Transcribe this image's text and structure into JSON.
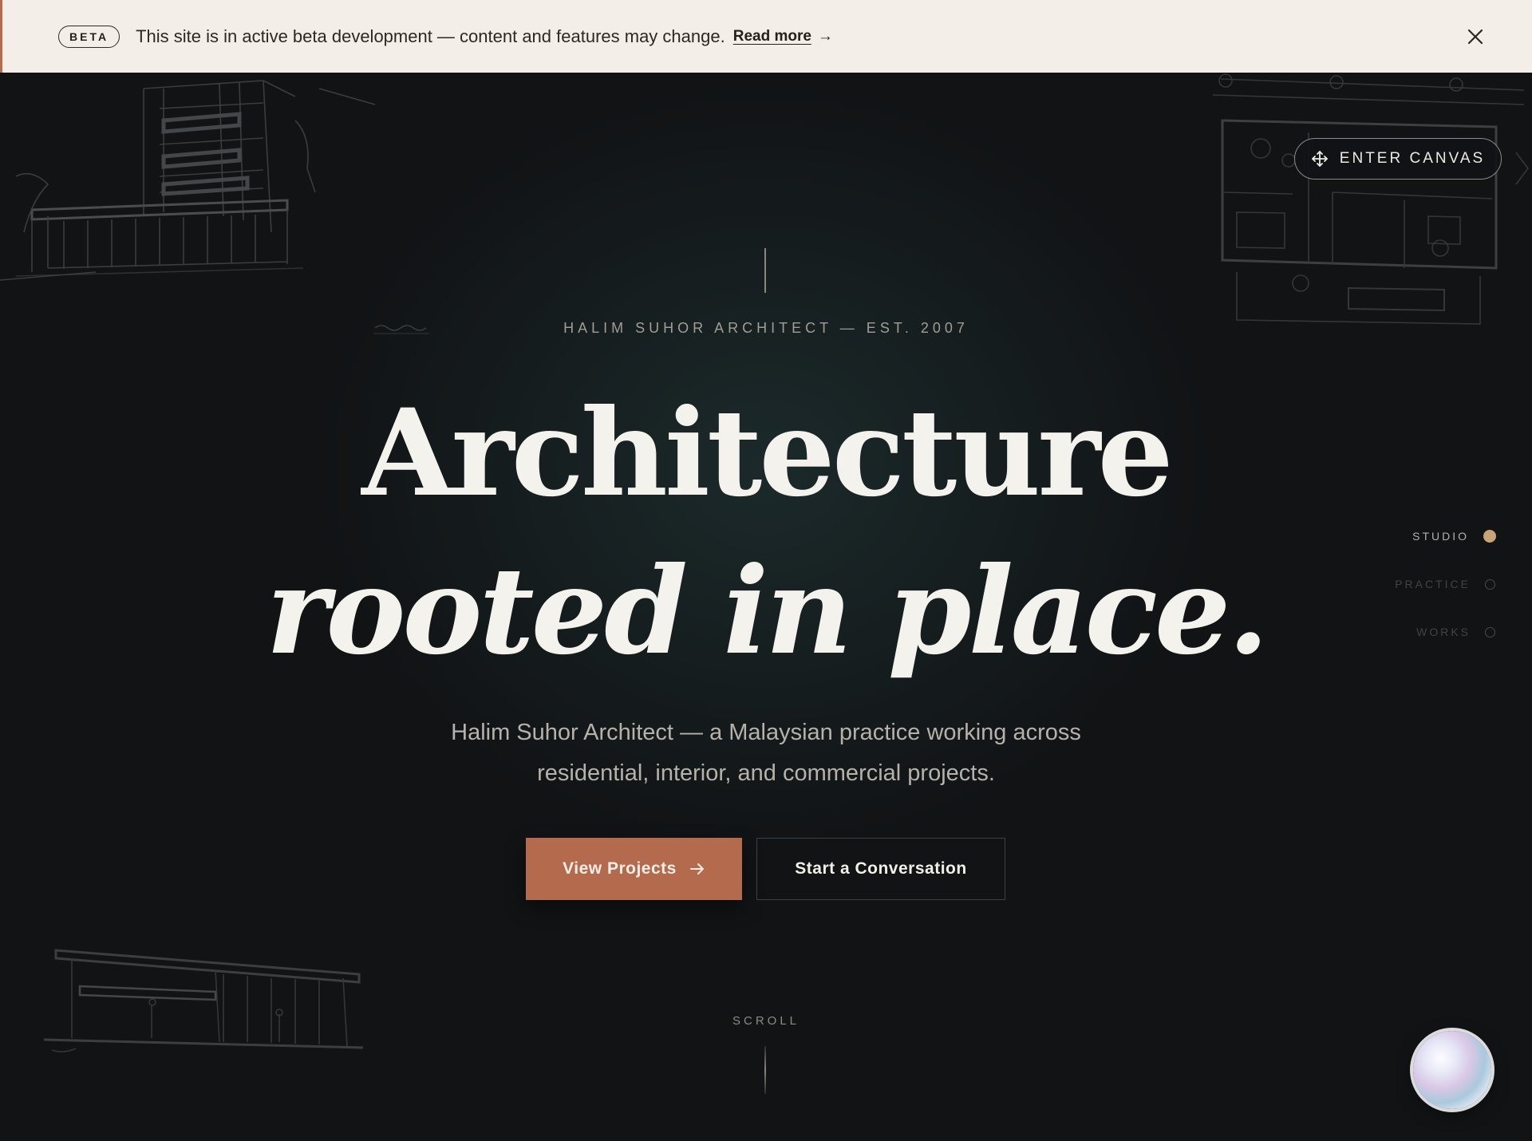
{
  "banner": {
    "badge": "BETA",
    "message": "This site is in active beta development — content and features may change.",
    "read_more": "Read more",
    "read_more_arrow": "→",
    "close_icon": "close-icon"
  },
  "hero": {
    "enter_canvas": "ENTER CANVAS",
    "eyebrow": "HALIM SUHOR ARCHITECT — EST. 2007",
    "headline_line1": "Architecture",
    "headline_line2": "rooted in place.",
    "subcopy_line1": "Halim Suhor Architect — a Malaysian practice working across",
    "subcopy_line2": "residential, interior, and commercial projects.",
    "primary_cta": "View Projects",
    "secondary_cta": "Start a Conversation",
    "scroll_label": "SCROLL"
  },
  "section_nav": {
    "items": [
      {
        "label": "STUDIO",
        "active": true
      },
      {
        "label": "PRACTICE",
        "active": false
      },
      {
        "label": "WORKS",
        "active": false
      }
    ]
  },
  "colors": {
    "background": "#111315",
    "banner_bg": "#f3efe8",
    "accent": "#b46a4c",
    "active_dot": "#c8a376",
    "headline": "#f4f2ec"
  }
}
